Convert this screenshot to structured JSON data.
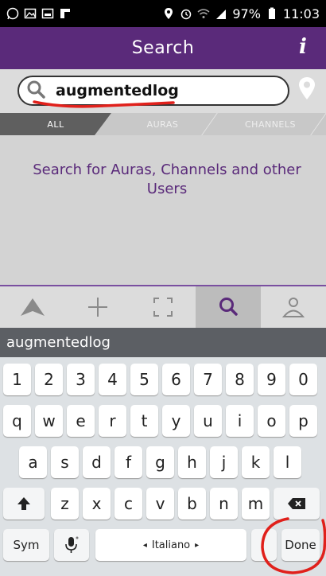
{
  "status_bar": {
    "battery": "97%",
    "time": "11:03"
  },
  "header": {
    "title": "Search",
    "info_label": "i"
  },
  "search": {
    "value": "augmentedlog",
    "placeholder": ""
  },
  "tabs": [
    {
      "label": "ALL"
    },
    {
      "label": "AURAS"
    },
    {
      "label": "CHANNELS"
    }
  ],
  "content": {
    "empty_message": "Search for Auras, Channels and other Users"
  },
  "keyboard": {
    "suggestion": "augmentedlog",
    "row_numbers": [
      "1",
      "2",
      "3",
      "4",
      "5",
      "6",
      "7",
      "8",
      "9",
      "0"
    ],
    "row1": [
      "q",
      "w",
      "e",
      "r",
      "t",
      "y",
      "u",
      "i",
      "o",
      "p"
    ],
    "row2": [
      "a",
      "s",
      "d",
      "f",
      "g",
      "h",
      "j",
      "k",
      "l"
    ],
    "row3": [
      "z",
      "x",
      "c",
      "v",
      "b",
      "n",
      "m"
    ],
    "sym_label": "Sym",
    "space_label": "Italiano",
    "done_label": "Done"
  },
  "colors": {
    "header_bg": "#5a2a7a",
    "annotation_red": "#e0201b",
    "keyboard_bg": "#dde1e4"
  }
}
